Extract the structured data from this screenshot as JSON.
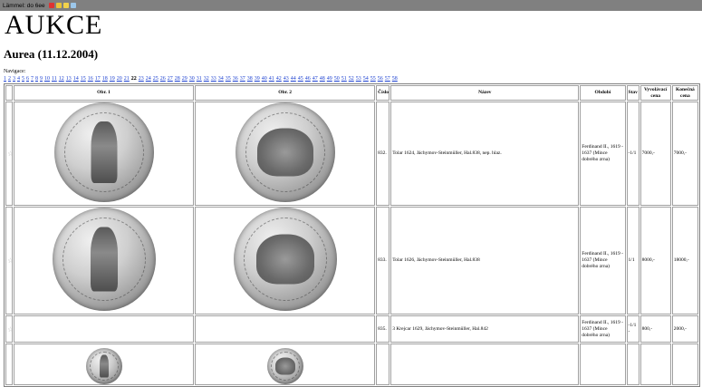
{
  "toolbar": {
    "label": "Lämmel: do 6ee"
  },
  "header": {
    "title": "AUKCE",
    "subtitle": "Aurea (11.12.2004)"
  },
  "navigation": {
    "label": "Navigace:",
    "current_page": "22",
    "pages": [
      "1",
      "2",
      "3",
      "4",
      "5",
      "6",
      "7",
      "8",
      "9",
      "10",
      "11",
      "12",
      "13",
      "14",
      "15",
      "16",
      "17",
      "18",
      "19",
      "20",
      "21",
      "22",
      "23",
      "24",
      "25",
      "26",
      "27",
      "28",
      "29",
      "30",
      "31",
      "32",
      "33",
      "34",
      "35",
      "36",
      "37",
      "38",
      "39",
      "40",
      "41",
      "42",
      "43",
      "44",
      "45",
      "46",
      "47",
      "48",
      "49",
      "50",
      "51",
      "52",
      "53",
      "54",
      "55",
      "56",
      "57",
      "58"
    ]
  },
  "table": {
    "columns": [
      "",
      "Obr. 1",
      "Obr. 2",
      "Číslo",
      "Název",
      "Období",
      "Stav",
      "Vyvolávací cena",
      "Konečná cena"
    ],
    "rows": [
      {
        "star": "☆",
        "number": "832.",
        "name": "Tolar 1624, Jáchymov-Steinmüller, Hal.838, nep. hlaz.",
        "period": "Ferdinand II., 1619 - 1637 (Mince dobrého zrna)",
        "condition": "-1/1",
        "start_price": "7000,-",
        "final_price": "7000,-"
      },
      {
        "star": "☆",
        "number": "833.",
        "name": "Tolar 1626, Jáchymov-Steinmüller, Hal.838",
        "period": "Ferdinand II., 1619 - 1637 (Mince dobrého zrna)",
        "condition": "1/1",
        "start_price": "8000,-",
        "final_price": "18000,-"
      },
      {
        "star": "☆",
        "number": "835.",
        "name": "3 Krejcar 1629, Jáchymov-Steinmüller, Hal.842",
        "period": "Ferdinand II., 1619 - 1637 (Mince dobrého zrna)",
        "condition": "-1/1 -",
        "start_price": "800,-",
        "final_price": "2000,-"
      },
      {
        "star": "",
        "number": "",
        "name": "",
        "period": "",
        "condition": "",
        "start_price": "",
        "final_price": ""
      }
    ]
  },
  "colors": {
    "toolbar_bg": "#808080",
    "link": "#1a3fd1",
    "border": "#a0a0a0",
    "coin_light": "#cfcfcf",
    "coin_dark": "#6f6f6f"
  }
}
